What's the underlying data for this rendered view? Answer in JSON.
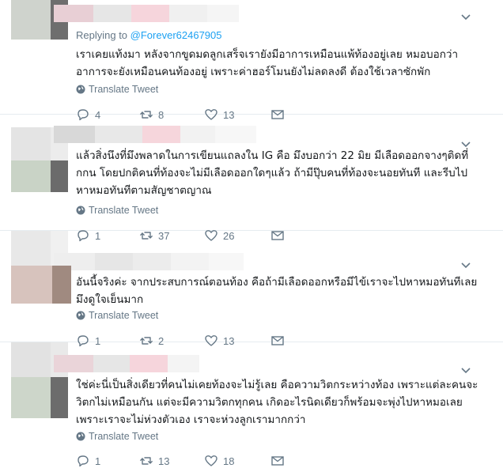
{
  "tweets": [
    {
      "replying_label": "Replying to",
      "replying_handle": "@Forever62467905",
      "lines": [
        "เราเคยแท้งมา หลังจากขูดมดลูกเสร็จเรายังมีอาการเหมือนแพ้ท้องอยู่เลย หมอบอกว่า",
        "อาการจะยังเหมือนคนท้องอยู่ เพราะค่าฮอร์โมนยังไม่ลดลงดี ต้องใช้เวลาซักพัก"
      ],
      "translate": "Translate Tweet",
      "replies": "4",
      "retweets": "8",
      "likes": "13"
    },
    {
      "lines": [
        "แล้วสิ่งนึงที่มึงพลาดในการเขียนแถลงใน IG คือ มึงบอกว่า 22 มิย มีเลือดออกจางๆติดที่",
        "กกน โดยปกติคนที่ท้องจะไม่มีเลือดออกใดๆแล้ว ถ้ามีปุ๊บคนที่ท้องจะนอยทันที และรีบไป",
        "หาหมอทันทีตามสัญชาตญาณ"
      ],
      "translate": "Translate Tweet",
      "replies": "1",
      "retweets": "37",
      "likes": "26"
    },
    {
      "lines": [
        "อันนี้จริงค่ะ จากประสบการณ์ตอนท้อง คือถ้ามีเลือดออกหรือมีไข้เราจะไปหาหมอทันทีเลย",
        "มึงดูใจเย็นมาก"
      ],
      "translate": "Translate Tweet",
      "replies": "1",
      "retweets": "2",
      "likes": "13"
    },
    {
      "lines": [
        "ใช่ค่ะนี่เป็นสิ่งเดียวที่คนไม่เคยท้องจะไม่รู้เลย คือความวิตกระหว่างท้อง เพราะแต่ละคนจะ",
        "วิตกไม่เหมือนกัน แต่จะมีความวิตกทุกคน เกิดอะไรนิดเดียวก็พร้อมจะพุ่งไปหาหมอเลย",
        "เพราะเราจะไม่ห่วงตัวเอง เราจะห่วงลูกเรามากกว่า"
      ],
      "translate": "Translate Tweet",
      "replies": "1",
      "retweets": "13",
      "likes": "18"
    }
  ],
  "colors": {
    "text": "#14171a",
    "secondary": "#657786",
    "link": "#1da1f2",
    "divider": "#e6ecf0"
  },
  "icons": [
    "chevron-down-icon",
    "globe-icon",
    "reply-icon",
    "retweet-icon",
    "like-icon",
    "message-icon"
  ]
}
